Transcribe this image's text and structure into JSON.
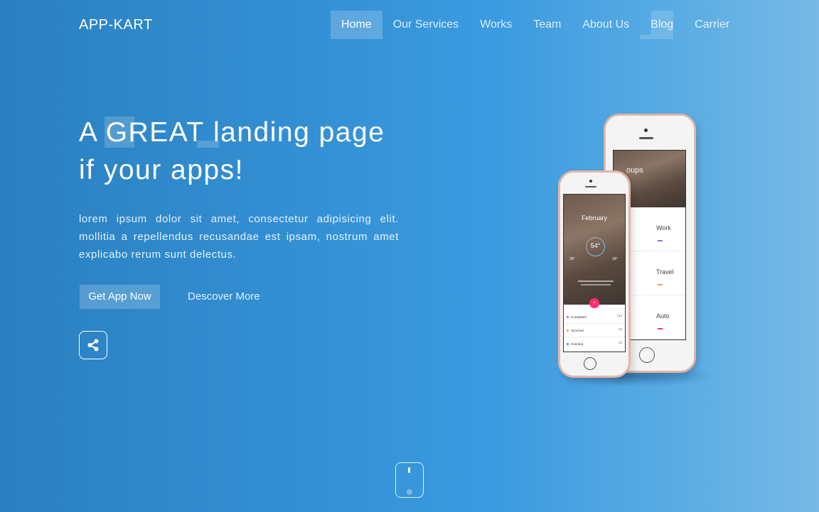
{
  "brand": "APP-KART",
  "nav": {
    "items": [
      {
        "label": "Home"
      },
      {
        "label": "Our Services"
      },
      {
        "label": "Works"
      },
      {
        "label": "Team"
      },
      {
        "label": "About Us"
      },
      {
        "label": "Blog"
      },
      {
        "label": "Carrier"
      }
    ],
    "active_index": 0
  },
  "hero": {
    "title_prefix": "A ",
    "title_highlight": "GREAT",
    "title_rest": " landing page if your apps!",
    "description": "lorem ipsum dolor sit amet, consectetur adipisicing elit. mollitia a repellendus recusandae est ipsam, nostrum amet explicabo rerum sunt delectus.",
    "primary_cta": "Get App Now",
    "secondary_cta": "Descover More"
  },
  "phone_back": {
    "header_label": "oups",
    "categories": [
      {
        "name": "Work",
        "color": "#9b6bd8"
      },
      {
        "name": "Travel",
        "color": "#f0a04b"
      },
      {
        "name": "Auto",
        "color": "#ff2d6f"
      }
    ]
  },
  "phone_front": {
    "month": "February",
    "temperature": "54°",
    "temp_left": "28°",
    "temp_right": "18°",
    "list": [
      {
        "label": "Completed",
        "value": "123",
        "color": "#9b6bd8"
      },
      {
        "label": "Snoozed",
        "value": "5k",
        "color": "#f0a04b"
      },
      {
        "label": "Overdue",
        "value": "3k",
        "color": "#3b8de0"
      }
    ]
  },
  "colors": {
    "accent_pink": "#ff2d6f",
    "rose_gold": "#e3b6a6",
    "background_start": "#2a80c0",
    "background_end": "#78b9e6"
  },
  "icons": {
    "share": "share-icon",
    "scroll": "mouse-scroll-icon"
  }
}
